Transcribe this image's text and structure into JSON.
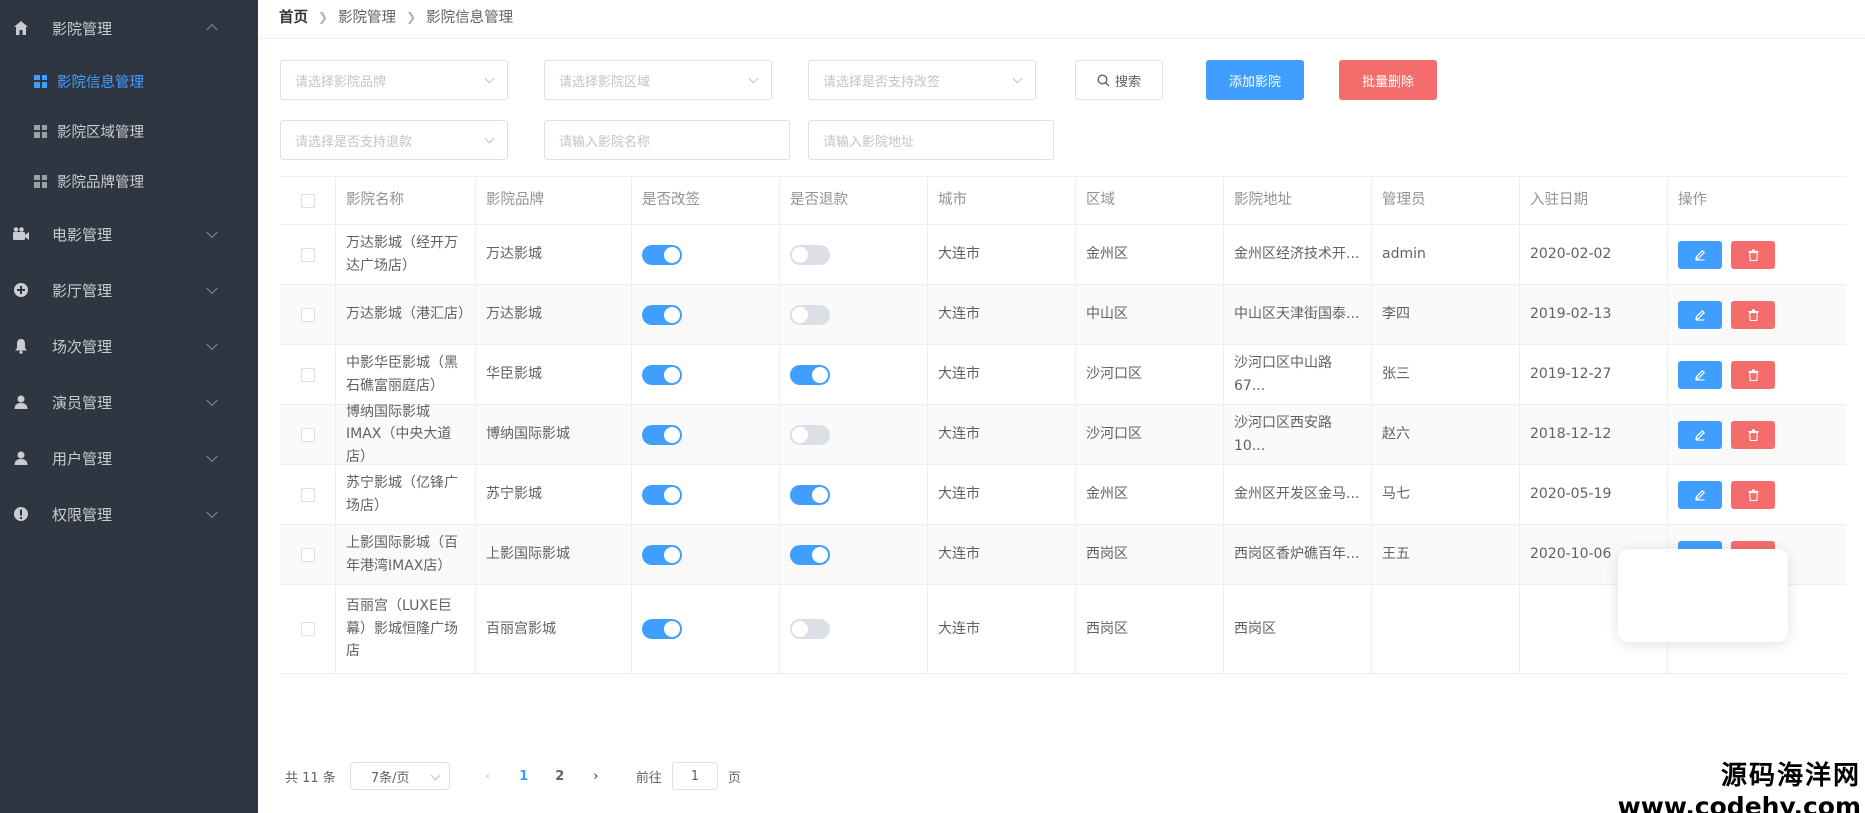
{
  "sidebar": {
    "items": [
      {
        "label": "影院管理",
        "icon": "home-icon",
        "expanded": true
      },
      {
        "label": "电影管理",
        "icon": "film-icon"
      },
      {
        "label": "影厅管理",
        "icon": "hall-icon"
      },
      {
        "label": "场次管理",
        "icon": "bell-icon"
      },
      {
        "label": "演员管理",
        "icon": "user-icon"
      },
      {
        "label": "用户管理",
        "icon": "user-icon"
      },
      {
        "label": "权限管理",
        "icon": "info-icon"
      }
    ],
    "sub_items": [
      {
        "label": "影院信息管理",
        "active": true
      },
      {
        "label": "影院区域管理"
      },
      {
        "label": "影院品牌管理"
      }
    ]
  },
  "breadcrumb": [
    "首页",
    "影院管理",
    "影院信息管理"
  ],
  "filters": {
    "brand_placeholder": "请选择影院品牌",
    "area_placeholder": "请选择影院区域",
    "change_placeholder": "请选择是否支持改签",
    "refund_placeholder": "请选择是否支持退款",
    "name_placeholder": "请输入影院名称",
    "address_placeholder": "请输入影院地址",
    "search_label": "搜索",
    "add_label": "添加影院",
    "batch_delete_label": "批量删除"
  },
  "table": {
    "columns": [
      "影院名称",
      "影院品牌",
      "是否改签",
      "是否退款",
      "城市",
      "区域",
      "影院地址",
      "管理员",
      "入驻日期",
      "操作"
    ],
    "rows": [
      {
        "name": "万达影城（经开万达广场店）",
        "brand": "万达影城",
        "change": true,
        "refund": false,
        "city": "大连市",
        "area": "金州区",
        "address": "金州区经济技术开...",
        "admin": "admin",
        "date": "2020-02-02"
      },
      {
        "name": "万达影城（港汇店）",
        "brand": "万达影城",
        "change": true,
        "refund": false,
        "city": "大连市",
        "area": "中山区",
        "address": "中山区天津街国泰...",
        "admin": "李四",
        "date": "2019-02-13"
      },
      {
        "name": "中影华臣影城（黑石礁富丽庭店）",
        "brand": "华臣影城",
        "change": true,
        "refund": true,
        "city": "大连市",
        "area": "沙河口区",
        "address": "沙河口区中山路67...",
        "admin": "张三",
        "date": "2019-12-27"
      },
      {
        "name": "博纳国际影城IMAX（中央大道店）",
        "brand": "博纳国际影城",
        "change": true,
        "refund": false,
        "city": "大连市",
        "area": "沙河口区",
        "address": "沙河口区西安路10...",
        "admin": "赵六",
        "date": "2018-12-12"
      },
      {
        "name": "苏宁影城（亿锋广场店）",
        "brand": "苏宁影城",
        "change": true,
        "refund": true,
        "city": "大连市",
        "area": "金州区",
        "address": "金州区开发区金马...",
        "admin": "马七",
        "date": "2020-05-19"
      },
      {
        "name": "上影国际影城（百年港湾IMAX店）",
        "brand": "上影国际影城",
        "change": true,
        "refund": true,
        "city": "大连市",
        "area": "西岗区",
        "address": "西岗区香炉礁百年...",
        "admin": "王五",
        "date": "2020-10-06"
      },
      {
        "name": "百丽宫（LUXE巨幕）影城恒隆广场店",
        "brand": "百丽宫影城",
        "change": true,
        "refund": false,
        "city": "大连市",
        "area": "西岗区",
        "address": "西岗区",
        "admin": "",
        "date": ""
      }
    ]
  },
  "pagination": {
    "total_label": "共 11 条",
    "page_size": "7条/页",
    "pages": [
      "1",
      "2"
    ],
    "current": "1",
    "goto_label": "前往",
    "goto_value": "1",
    "page_suffix": "页"
  },
  "watermark": {
    "line1": "源码海洋网",
    "line2": "www.codehy.com"
  },
  "colors": {
    "sidebar_bg": "#2f3541",
    "primary": "#409eff",
    "danger": "#f56c6c",
    "switch_off": "#dcdfe6"
  }
}
